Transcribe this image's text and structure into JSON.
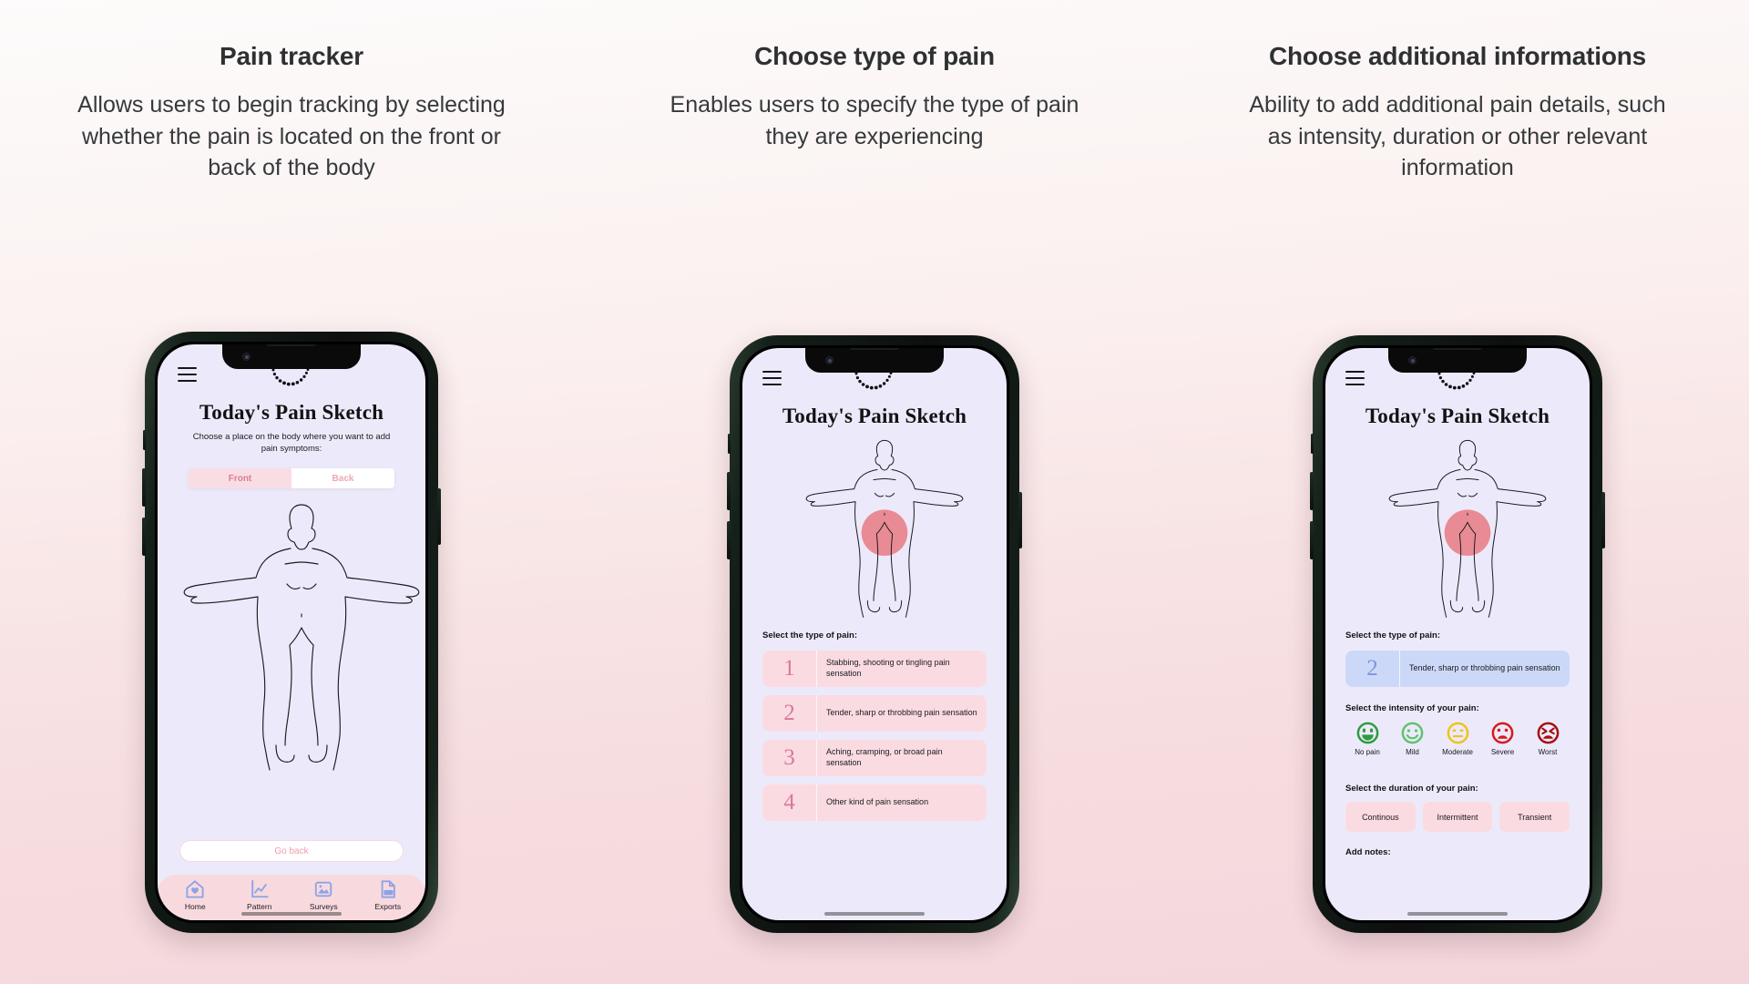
{
  "columns": [
    {
      "title": "Pain tracker",
      "description": "Allows users to begin tracking by selecting whether the pain is located on the front or back of the body"
    },
    {
      "title": "Choose type of pain",
      "description": "Enables users to specify the type of pain they are experiencing"
    },
    {
      "title": "Choose additional informations",
      "description": "Ability to add additional pain details, such as intensity, duration or other relevant information"
    }
  ],
  "app": {
    "title": "Today's Pain Sketch",
    "subtitle": "Choose a place on the body where you want to add pain symptoms:",
    "menu_icon": "hamburger-icon",
    "toggle": {
      "front": "Front",
      "back": "Back",
      "selected": "Front"
    },
    "go_back": "Go back",
    "tabs": [
      {
        "label": "Home",
        "icon": "home-heart-icon"
      },
      {
        "label": "Pattern",
        "icon": "line-chart-icon"
      },
      {
        "label": "Surveys",
        "icon": "image-folder-icon"
      },
      {
        "label": "Exports",
        "icon": "pdf-file-icon"
      }
    ],
    "type_label": "Select the type of pain:",
    "pain_types": [
      {
        "number": "1",
        "text": "Stabbing, shooting or tingling pain sensation"
      },
      {
        "number": "2",
        "text": "Tender, sharp or throbbing pain sensation"
      },
      {
        "number": "3",
        "text": "Aching, cramping, or broad pain sensation"
      },
      {
        "number": "4",
        "text": "Other kind of pain sensation"
      }
    ],
    "selected_pain_type": "2",
    "intensity_label": "Select the intensity of your pain:",
    "intensities": [
      {
        "label": "No pain",
        "color": "#2e9b3f",
        "mood": "happy-face-icon"
      },
      {
        "label": "Mild",
        "color": "#5ec46b",
        "mood": "smile-face-icon"
      },
      {
        "label": "Moderate",
        "color": "#f0c21a",
        "mood": "neutral-face-icon"
      },
      {
        "label": "Severe",
        "color": "#d71a1a",
        "mood": "frown-face-icon"
      },
      {
        "label": "Worst",
        "color": "#a80d0d",
        "mood": "distress-face-icon"
      }
    ],
    "duration_label": "Select the duration of your pain:",
    "durations": [
      "Continous",
      "Intermittent",
      "Transient"
    ],
    "notes_label": "Add notes:"
  },
  "colors": {
    "pink_accent": "#f8dade",
    "pink_option": "#fadbe1",
    "blue_selected": "#ccd8f7",
    "screen_bg": "#eceafa",
    "pain_marker": "#e98b94"
  }
}
